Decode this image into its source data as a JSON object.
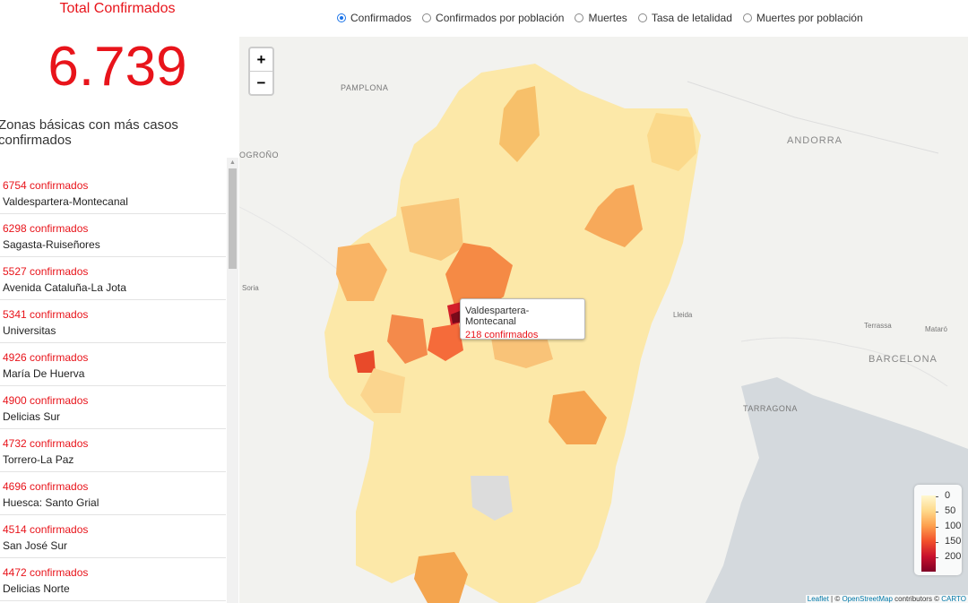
{
  "summary": {
    "title": "Total Confirmados",
    "value": "6.739"
  },
  "zones": {
    "title": "Zonas básicas con más casos confirmados",
    "items": [
      {
        "count": "6754 confirmados",
        "name": "Valdespartera-Montecanal"
      },
      {
        "count": "6298 confirmados",
        "name": "Sagasta-Ruiseñores"
      },
      {
        "count": "5527 confirmados",
        "name": "Avenida Cataluña-La Jota"
      },
      {
        "count": "5341 confirmados",
        "name": "Universitas"
      },
      {
        "count": "4926 confirmados",
        "name": "María De Huerva"
      },
      {
        "count": "4900 confirmados",
        "name": "Delicias Sur"
      },
      {
        "count": "4732 confirmados",
        "name": "Torrero-La Paz"
      },
      {
        "count": "4696 confirmados",
        "name": "Huesca: Santo Grial"
      },
      {
        "count": "4514 confirmados",
        "name": "San José Sur"
      },
      {
        "count": "4472 confirmados",
        "name": "Delicias Norte"
      }
    ]
  },
  "metrics": {
    "options": [
      "Confirmados",
      "Confirmados por población",
      "Muertes",
      "Tasa de letalidad",
      "Muertes por población"
    ],
    "selected": "Confirmados"
  },
  "map": {
    "zoom_in": "+",
    "zoom_out": "−",
    "places": [
      "PAMPLONA",
      "ANDORRA",
      "OGROÑO",
      "Soria",
      "Lleida",
      "Terrassa",
      "Mataró",
      "BARCELONA",
      "TARRAGONA"
    ],
    "tooltip": {
      "name": "Valdespartera-Montecanal",
      "count": "218 confirmados"
    },
    "legend": {
      "labels": [
        "0",
        "50",
        "100",
        "150",
        "200"
      ],
      "colors": [
        "#fff8d0",
        "#fed98b",
        "#fd9f4d",
        "#f2502b",
        "#c8102d",
        "#800026"
      ]
    },
    "attribution": {
      "leaflet": "Leaflet",
      "sep": " | © ",
      "osm": "OpenStreetMap",
      "contrib": " contributors © ",
      "carto": "CARTO"
    }
  }
}
